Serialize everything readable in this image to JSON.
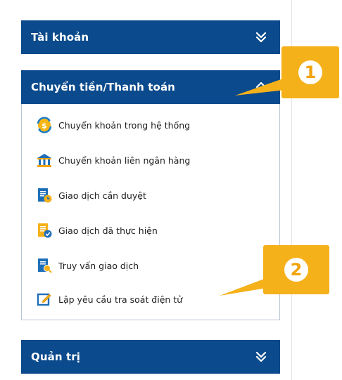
{
  "colors": {
    "header_bg": "#0b4a8c",
    "accent": "#f5b11a",
    "text": "#1d1d1d"
  },
  "menu": {
    "account": {
      "title": "Tài khoản",
      "state": "collapsed",
      "icon": "double-chevron-down-icon"
    },
    "transfer": {
      "title": "Chuyển tiền/Thanh toán",
      "state": "expanded",
      "icon": "double-chevron-up-icon",
      "items": [
        {
          "label": "Chuyển khoản trong hệ thống",
          "icon": "internal-transfer-icon"
        },
        {
          "label": "Chuyển khoản liên ngân hàng",
          "icon": "bank-icon"
        },
        {
          "label": "Giao dịch cần duyệt",
          "icon": "pending-document-icon"
        },
        {
          "label": "Giao dịch đã thực hiện",
          "icon": "completed-document-icon"
        },
        {
          "label": "Truy vấn giao dịch",
          "icon": "query-document-icon"
        },
        {
          "label": "Lập yêu cầu tra soát điện tử",
          "icon": "edit-form-icon"
        }
      ]
    },
    "admin": {
      "title": "Quản trị",
      "state": "collapsed",
      "icon": "double-chevron-down-icon"
    }
  },
  "annotations": [
    {
      "number": "1"
    },
    {
      "number": "2"
    }
  ]
}
